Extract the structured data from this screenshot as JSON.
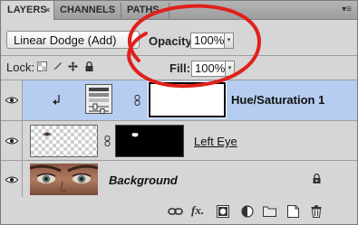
{
  "tabs": [
    {
      "label": "LAYERS",
      "active": true
    },
    {
      "label": "CHANNELS",
      "active": false
    },
    {
      "label": "PATHS",
      "active": false
    }
  ],
  "close_glyph": "×",
  "panel_menu_glyph": "▾≡",
  "blend_mode": {
    "value": "Linear Dodge (Add)",
    "arrows": "▲▼"
  },
  "opacity": {
    "label": "Opacity:",
    "value": "100%",
    "arrow": "▾"
  },
  "lock": {
    "label": "Lock:",
    "icons": [
      "lock-transparent-pixels-icon",
      "lock-image-pixels-icon",
      "lock-position-icon",
      "lock-all-icon"
    ]
  },
  "fill": {
    "label": "Fill:",
    "value": "100%",
    "arrow": "▾"
  },
  "layers": [
    {
      "name": "Hue/Saturation 1",
      "type": "adjustment",
      "selected": true,
      "clipped": true
    },
    {
      "name": "Left Eye",
      "type": "pixel-with-mask",
      "selected": false
    },
    {
      "name": "Background",
      "type": "background",
      "selected": false,
      "locked": true
    }
  ],
  "footer_icons": [
    "link-layers-icon",
    "layer-style-icon",
    "add-mask-icon",
    "adjustment-layer-icon",
    "new-group-icon",
    "new-layer-icon",
    "delete-layer-icon"
  ],
  "footer_fx_label": "fx.",
  "colors": {
    "selected_row": "#b5cdf0",
    "annotation": "#e0201c",
    "panel_bg": "#d6d6d6"
  }
}
